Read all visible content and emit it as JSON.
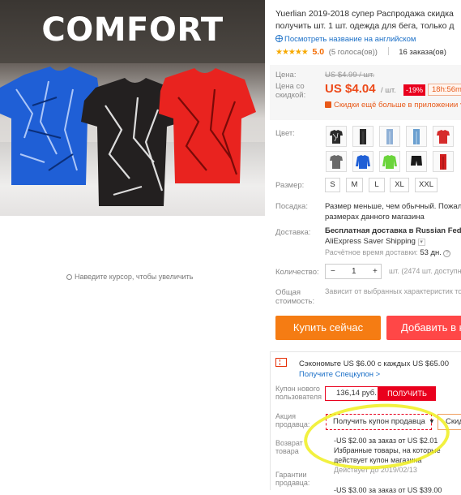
{
  "product_image": {
    "banner": "COMFORT",
    "zoom_hint": "Наведите курсор, чтобы увеличить",
    "colors": {
      "shirt1": "#1f5fd6",
      "shirt2": "#232020",
      "shirt3": "#e9231f"
    }
  },
  "product": {
    "title": "Yuerlian 2019-2018 супер Распродажа скидка",
    "title_line2": "получить шт. 1 шт. одежда для бега, только д",
    "translate_link": "Посмотреть название на английском",
    "rating": {
      "stars": "★★★★★",
      "score": "5.0",
      "votes": "(5 голоса(ов))",
      "orders": "16 заказа(ов)"
    }
  },
  "price": {
    "old_label": "Цена:",
    "old_value": "US $4.99 / шт.",
    "new_label": "Цена со скидкой:",
    "new_value": "US $4.04",
    "per_unit": "/ шт.",
    "discount": "-19%",
    "timer": "18h:56m",
    "app_deal": "Скидки ещё больше в приложении"
  },
  "options": {
    "color_label": "Цвет:",
    "color_swatches": [
      "#2b2b2b",
      "#2a2a2a",
      "#8fb0d6",
      "#6a9fd0",
      "#d62c2c",
      "#6a6a6a",
      "#1f5fd6",
      "#6ad43a",
      "#1a1a1a",
      "#d11f1f"
    ],
    "size_label": "Размер:",
    "sizes": [
      "S",
      "M",
      "L",
      "XL",
      "XXL"
    ],
    "fit_label": "Посадка:",
    "fit_line1": "Размер меньше, чем обычный. Пожалуй",
    "fit_line2": "размерах данного магазина",
    "delivery_label": "Доставка:",
    "delivery_line1": "Бесплатная доставка в Russian Federa",
    "delivery_line2": "AliExpress Saver Shipping",
    "delivery_time_label": "Расчётное время доставки:",
    "delivery_time": "53 дн.",
    "qty_label": "Количество:",
    "qty_minus": "−",
    "qty_value": "1",
    "qty_plus": "+",
    "qty_note": "шт. (2474 шт. доступн",
    "total_label_1": "Общая",
    "total_label_2": "стоимость:",
    "total_text": "Зависит от выбранных характеристик то"
  },
  "actions": {
    "buy_now": "Купить сейчас",
    "add_to_cart": "Добавить в к"
  },
  "coupons": {
    "saving_line1": "Сэкономьте US $6.00 с каждых US $65.00",
    "saving_line2": "Получите Спецкупон >",
    "new_user_label_1": "Купон нового",
    "new_user_label_2": "пользователя",
    "coupon_value": "136,14 руб.",
    "get_button": "ПОЛУЧИТЬ",
    "seller_promo_label_1": "Акция",
    "seller_promo_label_2": "продавца:",
    "seller_coupon_select": "Получить купон продавца",
    "second_select": "Скид",
    "return_label_1": "Возврат",
    "return_label_2": "товара",
    "guarantee_label_1": "Гарантии",
    "guarantee_label_2": "продавца:",
    "deal_line1": "-US $2.00 за заказ от US $2.01",
    "deal_line2": "Избранные товары, на которые",
    "deal_line3": "действует купон магазина",
    "deal_line4": "Действует до 2019/02/13",
    "deal_line5": "-US $3.00 за заказ от US $39.00"
  }
}
